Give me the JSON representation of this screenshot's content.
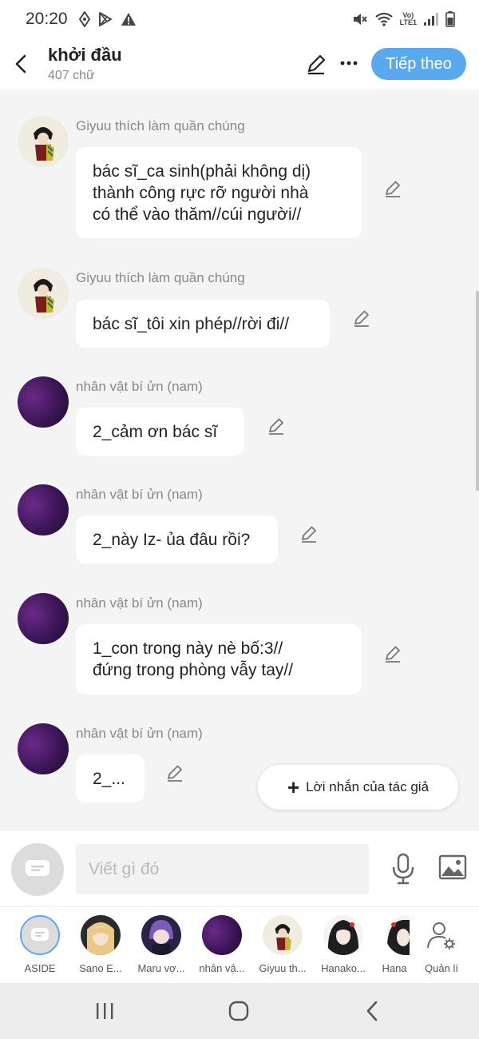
{
  "status_bar": {
    "time": "20:20",
    "network": "LTE1"
  },
  "header": {
    "title": "khởi đầu",
    "word_count": "407 chữ",
    "next_label": "Tiếp theo"
  },
  "messages": [
    {
      "sender": "Giyuu thích làm quần chúng",
      "text": "bác sĩ_ca sinh(phải không dị)\nthành công rực rỡ người nhà\ncó thể vào thăm//cúi người//",
      "avatar": "giyuu"
    },
    {
      "sender": "Giyuu thích làm quần chúng",
      "text": "bác sĩ_tôi xin phép//rời đi//",
      "avatar": "giyuu"
    },
    {
      "sender": "nhân vật bí ửn (nam)",
      "text": "2_cảm ơn bác sĩ",
      "avatar": "purple"
    },
    {
      "sender": "nhân vật bí ửn (nam)",
      "text": "2_này Iz- ủa đâu rồi?",
      "avatar": "purple"
    },
    {
      "sender": "nhân vật bí ửn (nam)",
      "text": "1_con trong này nè bố:3//\nđứng trong phòng vẫy tay//",
      "avatar": "purple"
    },
    {
      "sender": "nhân vật bí ửn (nam)",
      "text": "2_...",
      "avatar": "purple"
    }
  ],
  "author_note_label": "Lời nhắn của tác giả",
  "input": {
    "placeholder": "Viết gì đó"
  },
  "characters": [
    {
      "label": "ASIDE"
    },
    {
      "label": "Sano E..."
    },
    {
      "label": "Maru vợ..."
    },
    {
      "label": "nhân vậ..."
    },
    {
      "label": "Giyuu th..."
    },
    {
      "label": "Hanako..."
    },
    {
      "label": "Hana"
    },
    {
      "label": "Quản lí"
    }
  ],
  "colors": {
    "accent": "#5aa9ef",
    "background": "#f4f4f4",
    "bubble": "#ffffff",
    "avatar_purple": "#4a1d6b"
  }
}
